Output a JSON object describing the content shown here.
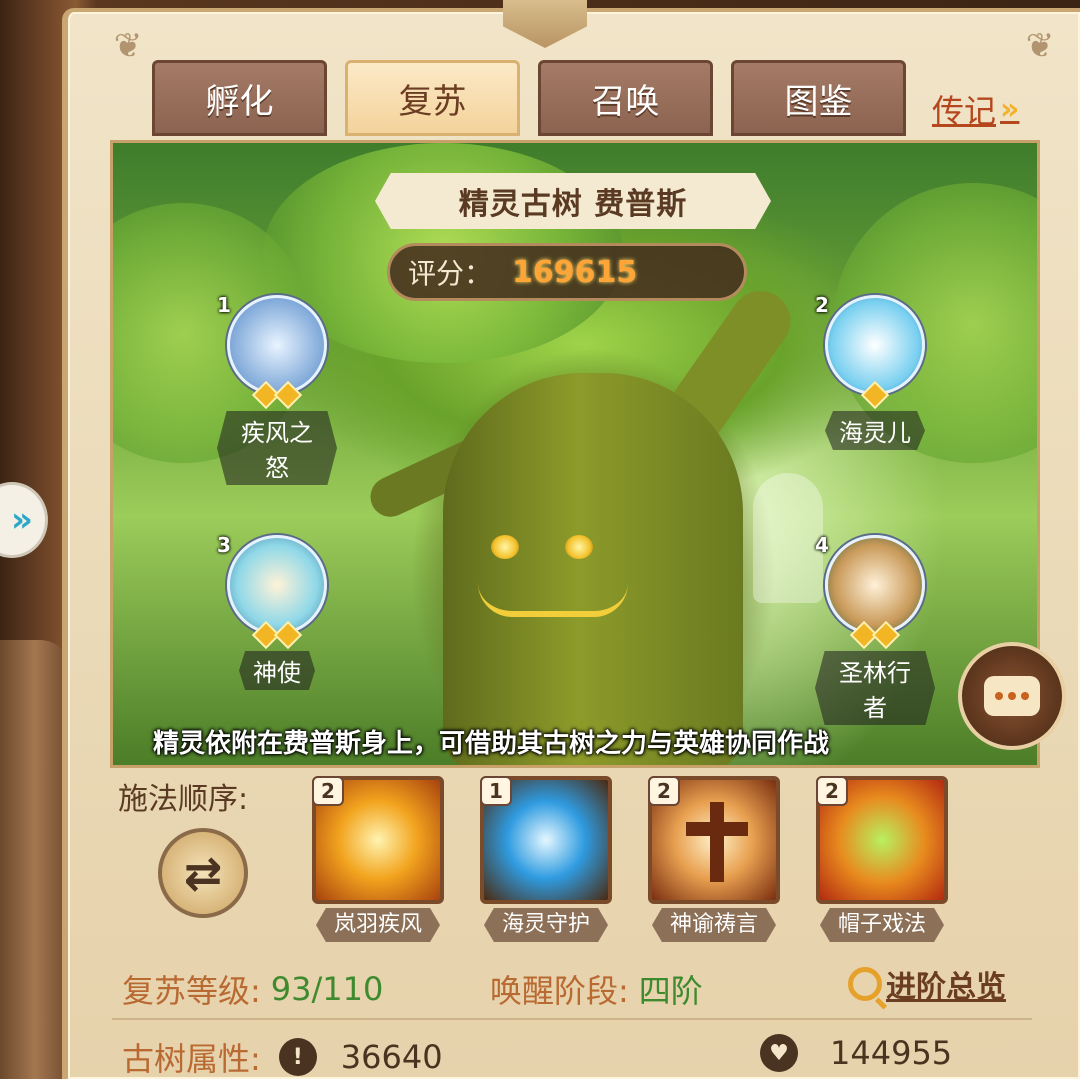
{
  "tabs": [
    {
      "label": "孵化",
      "active": false
    },
    {
      "label": "复苏",
      "active": true
    },
    {
      "label": "召唤",
      "active": false
    },
    {
      "label": "图鉴",
      "active": false
    }
  ],
  "legend_link": {
    "label": "传记",
    "chevron": "»"
  },
  "tree": {
    "name": "精灵古树 费普斯",
    "score_label": "评分：",
    "score_value": "169615",
    "caption": "精灵依附在费普斯身上，可借助其古树之力与英雄协同作战"
  },
  "spirits": [
    {
      "slot": "1",
      "name": "疾风之怒",
      "stars": 2,
      "color": "#7fa8d8"
    },
    {
      "slot": "2",
      "name": "海灵儿",
      "stars": 1,
      "color": "#7ad0f0"
    },
    {
      "slot": "3",
      "name": "神使",
      "stars": 2,
      "color": "#8fd8e8"
    },
    {
      "slot": "4",
      "name": "圣林行者",
      "stars": 2,
      "color": "#c99a5a"
    }
  ],
  "cast_order": {
    "label": "施法顺序:",
    "swap_icon": "swap-icon",
    "skills": [
      {
        "level": "2",
        "name": "岚羽疾风",
        "icon": "whirlwind-skill-icon",
        "color": "#e88a1e"
      },
      {
        "level": "1",
        "name": "海灵守护",
        "icon": "crystal-shield-skill-icon",
        "color": "#2f9be0"
      },
      {
        "level": "2",
        "name": "神谕祷言",
        "icon": "holy-cross-skill-icon",
        "color": "#b05a1a"
      },
      {
        "level": "2",
        "name": "帽子戏法",
        "icon": "magic-hat-skill-icon",
        "color": "#e05a1a"
      }
    ]
  },
  "revival": {
    "level_label": "复苏等级:",
    "level_value": "93/110",
    "stage_label": "唤醒阶段:",
    "stage_value": "四阶",
    "overview_label": "进阶总览"
  },
  "attributes": {
    "label": "古树属性:",
    "attack_icon": "attack-icon",
    "attack_value": "36640",
    "hp_icon": "heart-icon",
    "hp_value": "144955"
  }
}
